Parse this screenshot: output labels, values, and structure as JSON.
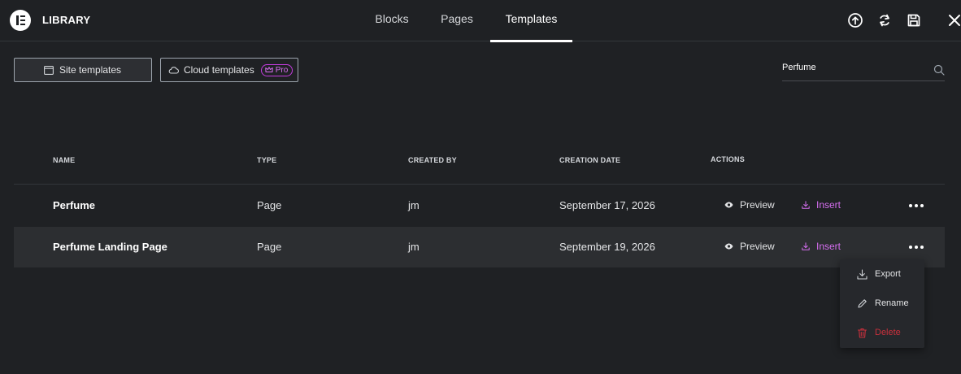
{
  "header": {
    "title": "LIBRARY",
    "tabs": [
      {
        "label": "Blocks",
        "active": false
      },
      {
        "label": "Pages",
        "active": false
      },
      {
        "label": "Templates",
        "active": true
      }
    ],
    "icons": [
      "upload-icon",
      "sync-icon",
      "save-icon",
      "close-icon"
    ]
  },
  "filters": {
    "site_templates": "Site templates",
    "cloud_templates": "Cloud templates",
    "pro_badge": "Pro"
  },
  "search": {
    "value": "Perfume",
    "placeholder": ""
  },
  "table": {
    "columns": [
      "NAME",
      "TYPE",
      "CREATED BY",
      "CREATION DATE",
      "ACTIONS"
    ],
    "rows": [
      {
        "name": "Perfume",
        "type": "Page",
        "created_by": "jm",
        "date": "September 17, 2026",
        "preview": "Preview",
        "insert": "Insert"
      },
      {
        "name": "Perfume Landing Page",
        "type": "Page",
        "created_by": "jm",
        "date": "September 19, 2026",
        "preview": "Preview",
        "insert": "Insert"
      }
    ]
  },
  "row_menu": {
    "items": [
      {
        "label": "Export",
        "icon": "download-icon"
      },
      {
        "label": "Rename",
        "icon": "pencil-icon"
      },
      {
        "label": "Delete",
        "icon": "trash-icon"
      }
    ]
  },
  "colors": {
    "background": "#1f2124",
    "accent_pink": "#d56ef0",
    "danger": "#c8303c",
    "text": "#e4e5e7"
  }
}
